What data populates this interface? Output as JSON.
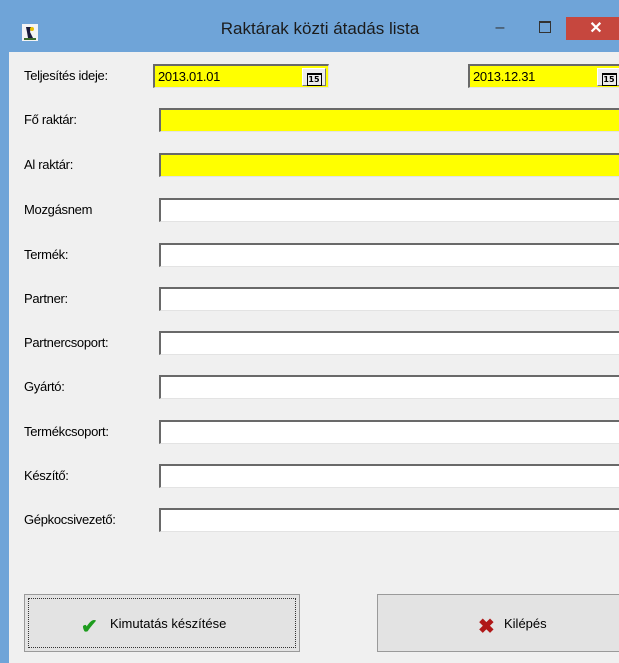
{
  "window": {
    "title": "Raktárak közti átadás lista",
    "minimize_glyph": "–",
    "close_glyph": "✕"
  },
  "form": {
    "date_row": {
      "label": "Teljesítés ideje:",
      "date_from": "2013.01.01",
      "date_to": "2013.12.31",
      "calendar_icon_text": "15"
    },
    "main_warehouse": {
      "label": "Fő raktár:",
      "value": ""
    },
    "sub_warehouse": {
      "label": "Al raktár:",
      "value": ""
    },
    "movement_type": {
      "label": "Mozgásnem",
      "value": ""
    },
    "product": {
      "label": "Termék:",
      "value": ""
    },
    "partner": {
      "label": "Partner:",
      "value": ""
    },
    "partner_group": {
      "label": "Partnercsoport:",
      "value": ""
    },
    "manufacturer": {
      "label": "Gyártó:",
      "value": ""
    },
    "product_group": {
      "label": "Termékcsoport:",
      "value": ""
    },
    "creator": {
      "label": "Készítő:",
      "value": ""
    },
    "driver": {
      "label": "Gépkocsivezető:",
      "value": ""
    }
  },
  "buttons": {
    "report": {
      "label": "Kimutatás készítése",
      "icon": "checkmark-icon",
      "icon_glyph": "✔"
    },
    "exit": {
      "label": "Kilépés",
      "icon": "x-icon",
      "icon_glyph": "✖"
    }
  },
  "colors": {
    "titlebar": "#6fa4d8",
    "close_button": "#c6473e",
    "required_field": "#ffff00",
    "checkmark": "#1e9c1e",
    "x_mark": "#b01818"
  }
}
